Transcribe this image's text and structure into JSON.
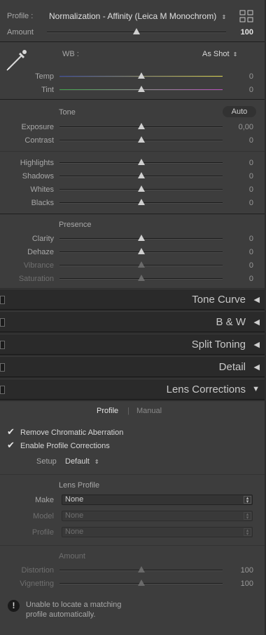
{
  "top": {
    "profile_label": "Profile :",
    "profile_value": "Normalization - Affinity (Leica M Monochrom)",
    "amount_label": "Amount",
    "amount_value": "100",
    "amount_fraction": 0.5
  },
  "wb": {
    "label": "WB :",
    "value": "As Shot",
    "sliders": [
      {
        "label": "Temp",
        "value": "0",
        "pos": 0.5
      },
      {
        "label": "Tint",
        "value": "0",
        "pos": 0.5
      }
    ]
  },
  "tone": {
    "label": "Tone",
    "auto_label": "Auto",
    "sliders": [
      {
        "label": "Exposure",
        "value": "0,00",
        "pos": 0.5
      },
      {
        "label": "Contrast",
        "value": "0",
        "pos": 0.5
      }
    ],
    "sliders2": [
      {
        "label": "Highlights",
        "value": "0",
        "pos": 0.5
      },
      {
        "label": "Shadows",
        "value": "0",
        "pos": 0.5
      },
      {
        "label": "Whites",
        "value": "0",
        "pos": 0.5
      },
      {
        "label": "Blacks",
        "value": "0",
        "pos": 0.5
      }
    ]
  },
  "presence": {
    "label": "Presence",
    "sliders": [
      {
        "label": "Clarity",
        "value": "0",
        "pos": 0.5
      },
      {
        "label": "Dehaze",
        "value": "0",
        "pos": 0.5
      },
      {
        "label": "Vibrance",
        "value": "0",
        "pos": 0.5
      },
      {
        "label": "Saturation",
        "value": "0",
        "pos": 0.5
      }
    ]
  },
  "sections": [
    {
      "name": "Tone Curve",
      "arrow": "◀"
    },
    {
      "name": "B & W",
      "arrow": "◀"
    },
    {
      "name": "Split Toning",
      "arrow": "◀"
    },
    {
      "name": "Detail",
      "arrow": "◀"
    },
    {
      "name": "Lens Corrections",
      "arrow": "▼"
    }
  ],
  "lens": {
    "tab_profile": "Profile",
    "tab_sep": "|",
    "tab_manual": "Manual",
    "remove_ca_label": "Remove Chromatic Aberration",
    "enable_profile_label": "Enable Profile Corrections",
    "checkmark": "✔",
    "setup_label": "Setup",
    "setup_value": "Default",
    "lens_profile_label": "Lens Profile",
    "make_label": "Make",
    "make_value": "None",
    "model_label": "Model",
    "model_value": "None",
    "profile_label": "Profile",
    "profile_value": "None",
    "amount_label": "Amount",
    "distortion_label": "Distortion",
    "distortion_value": "100",
    "vignetting_label": "Vignetting",
    "vignetting_value": "100",
    "warning_text_1": "Unable to locate a matching",
    "warning_text_2": "profile automatically."
  }
}
